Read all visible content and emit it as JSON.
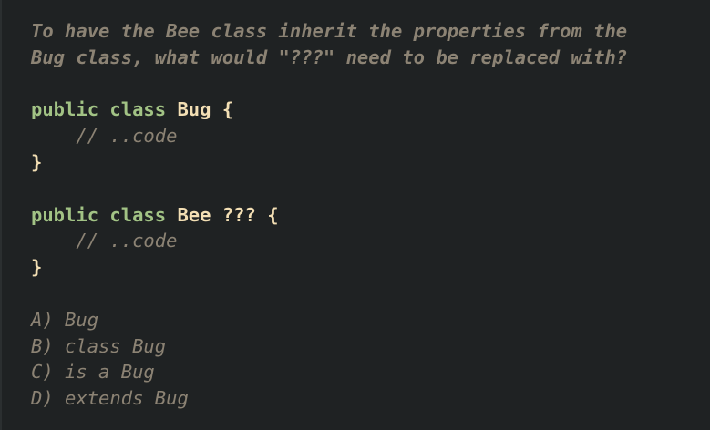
{
  "question": {
    "line1": "To have the Bee class inherit the properties from the",
    "line2": "Bug class, what would \"???\" need to be replaced with?"
  },
  "code": {
    "block1": {
      "public_kw": "public",
      "class_kw": "class",
      "class_name": "Bug",
      "open_brace": "{",
      "comment": "// ..code",
      "close_brace": "}"
    },
    "block2": {
      "public_kw": "public",
      "class_kw": "class",
      "class_name": "Bee",
      "placeholder": "???",
      "open_brace": "{",
      "comment": "// ..code",
      "close_brace": "}"
    }
  },
  "answers": [
    "A) Bug",
    "B) class Bug",
    "C) is a Bug",
    "D) extends Bug"
  ],
  "colors": {
    "background": "#1f2223",
    "comment": "#8c8374",
    "keyword": "#a2c385",
    "type": "#f3dfb4"
  }
}
